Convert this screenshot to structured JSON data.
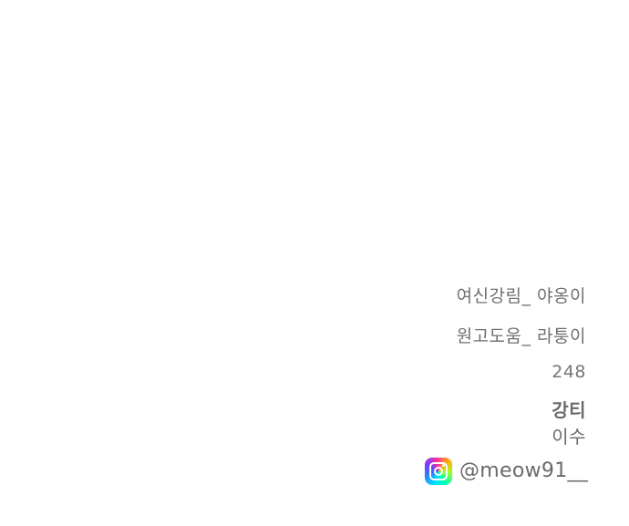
{
  "credits": {
    "original_story": "여신강림_ 야옹이",
    "manuscript_help": "원고도움_ 라퉁이",
    "episode_number": "248",
    "name_line_1": "강티",
    "name_line_2": "이수"
  },
  "social": {
    "icon": "instagram-icon",
    "handle": "@meow91__"
  }
}
